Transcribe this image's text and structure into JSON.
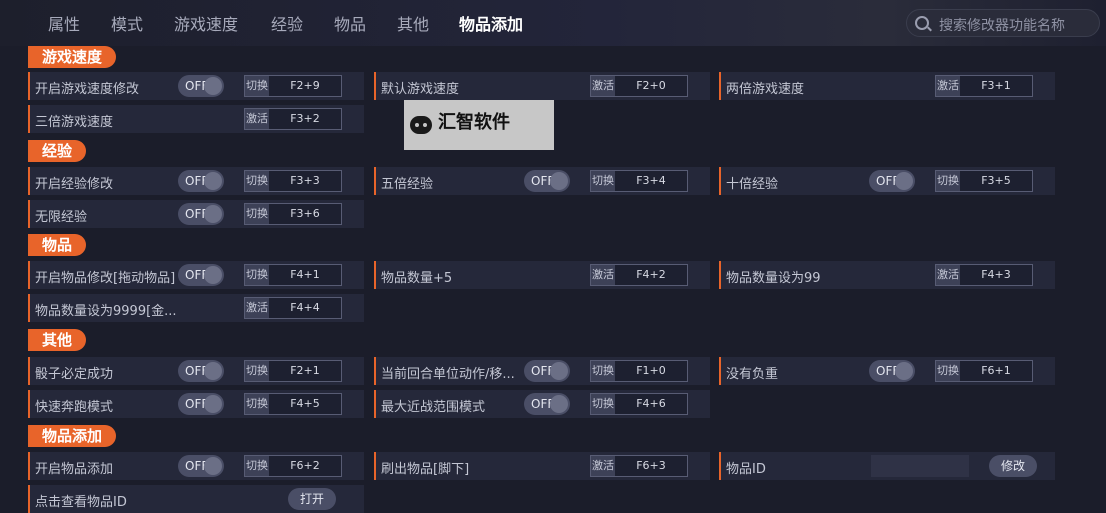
{
  "tabs": [
    "属性",
    "模式",
    "游戏速度",
    "经验",
    "物品",
    "其他",
    "物品添加"
  ],
  "active_tab": "物品添加",
  "search": {
    "placeholder": "搜索修改器功能名称"
  },
  "watermark": {
    "text": "汇智软件"
  },
  "toggle_off_label": "OFF",
  "sections": {
    "speed": {
      "title": "游戏速度",
      "items": [
        {
          "label": "开启游戏速度修改",
          "state": "OFF",
          "action": "切换",
          "key": "F2+9"
        },
        {
          "label": "默认游戏速度",
          "action": "激活",
          "key": "F2+0"
        },
        {
          "label": "两倍游戏速度",
          "action": "激活",
          "key": "F3+1"
        },
        {
          "label": "三倍游戏速度",
          "action": "激活",
          "key": "F3+2"
        }
      ]
    },
    "exp": {
      "title": "经验",
      "items": [
        {
          "label": "开启经验修改",
          "state": "OFF",
          "action": "切换",
          "key": "F3+3"
        },
        {
          "label": "五倍经验",
          "state": "OFF",
          "action": "切换",
          "key": "F3+4"
        },
        {
          "label": "十倍经验",
          "state": "OFF",
          "action": "切换",
          "key": "F3+5"
        },
        {
          "label": "无限经验",
          "state": "OFF",
          "action": "切换",
          "key": "F3+6"
        }
      ]
    },
    "items": {
      "title": "物品",
      "items": [
        {
          "label": "开启物品修改[拖动物品]",
          "state": "OFF",
          "action": "切换",
          "key": "F4+1"
        },
        {
          "label": "物品数量+5",
          "action": "激活",
          "key": "F4+2"
        },
        {
          "label": "物品数量设为99",
          "action": "激活",
          "key": "F4+3"
        },
        {
          "label": "物品数量设为9999[金...",
          "action": "激活",
          "key": "F4+4"
        }
      ]
    },
    "other": {
      "title": "其他",
      "items": [
        {
          "label": "骰子必定成功",
          "state": "OFF",
          "action": "切换",
          "key": "F2+1"
        },
        {
          "label": "当前回合单位动作/移...",
          "state": "OFF",
          "action": "切换",
          "key": "F1+0"
        },
        {
          "label": "没有负重",
          "state": "OFF",
          "action": "切换",
          "key": "F6+1"
        },
        {
          "label": "快速奔跑模式",
          "state": "OFF",
          "action": "切换",
          "key": "F4+5"
        },
        {
          "label": "最大近战范围模式",
          "state": "OFF",
          "action": "切换",
          "key": "F4+6"
        }
      ]
    },
    "add": {
      "title": "物品添加",
      "items": [
        {
          "label": "开启物品添加",
          "state": "OFF",
          "action": "切换",
          "key": "F6+2"
        },
        {
          "label": "刷出物品[脚下]",
          "action": "激活",
          "key": "F6+3"
        },
        {
          "label": "物品ID",
          "button": "修改"
        },
        {
          "label": "点击查看物品ID",
          "button": "打开"
        }
      ]
    }
  },
  "colors": {
    "accent": "#e8642a",
    "card": "#25283a",
    "background": "#1b1d2a"
  }
}
